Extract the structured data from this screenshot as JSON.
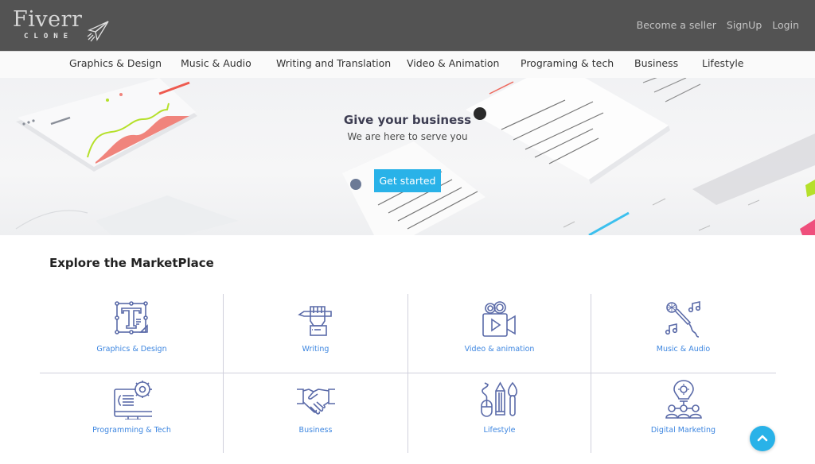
{
  "header": {
    "logo_text": "Fiverr",
    "logo_subtext": "CLONE",
    "links": [
      {
        "label": "Become a seller"
      },
      {
        "label": "SignUp"
      },
      {
        "label": "Login"
      }
    ]
  },
  "category_nav": [
    {
      "label": "Graphics & Design"
    },
    {
      "label": "Music & Audio"
    },
    {
      "label": "Writing and Translation"
    },
    {
      "label": "Video & Animation"
    },
    {
      "label": "Programing & tech"
    },
    {
      "label": "Business"
    },
    {
      "label": "Lifestyle"
    }
  ],
  "hero": {
    "title": "Give your business",
    "subtitle": "We are here to serve you",
    "cta_label": "Get started",
    "cta_color": "#29b2e8"
  },
  "marketplace": {
    "title": "Explore the MarketPlace",
    "link_color": "#3d86e0",
    "icon_color": "#5a6aa8",
    "items": [
      {
        "label": "Graphics & Design",
        "icon": "graphics-design-icon"
      },
      {
        "label": "Writing",
        "icon": "writing-icon"
      },
      {
        "label": "Video & animation",
        "icon": "video-camera-icon"
      },
      {
        "label": "Music & Audio",
        "icon": "microphone-icon"
      },
      {
        "label": "Programming & Tech",
        "icon": "programming-monitor-icon"
      },
      {
        "label": "Business",
        "icon": "handshake-icon"
      },
      {
        "label": "Lifestyle",
        "icon": "lifestyle-tools-icon"
      },
      {
        "label": "Digital Marketing",
        "icon": "digital-marketing-icon"
      }
    ]
  },
  "scroll_to_top": {
    "icon": "chevron-up-icon"
  }
}
